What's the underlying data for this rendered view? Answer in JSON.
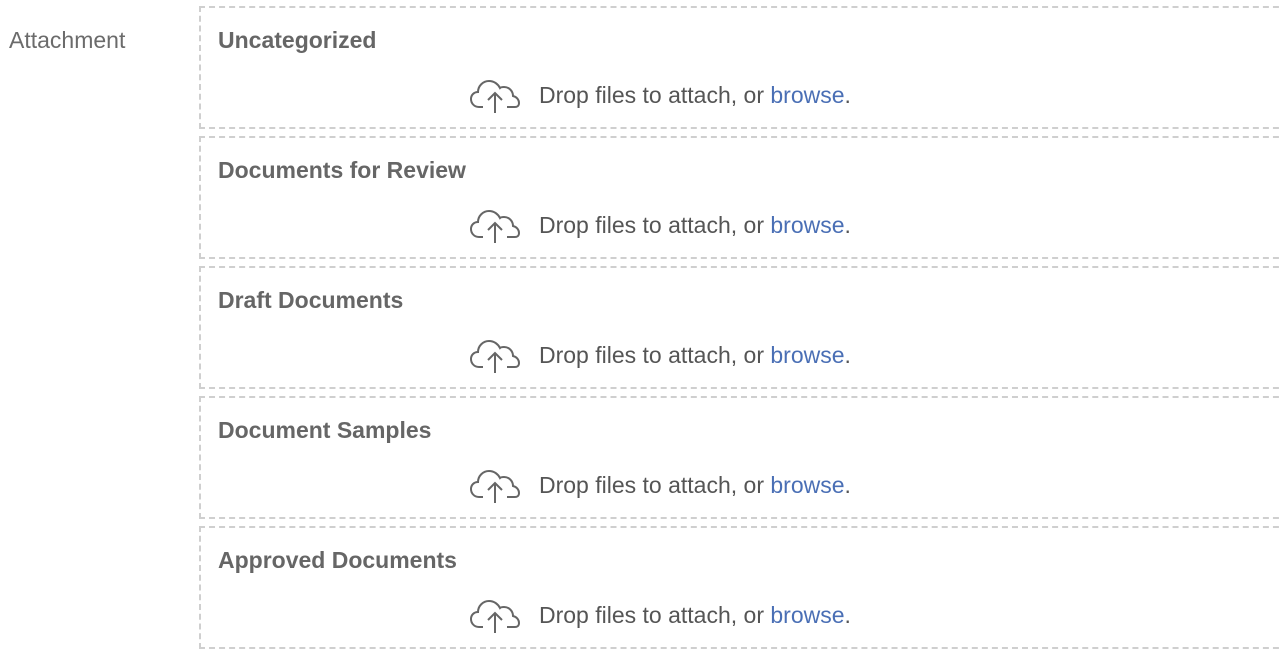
{
  "field": {
    "label": "Attachment"
  },
  "zones": [
    {
      "title": "Uncategorized",
      "prompt": "Drop files to attach, or",
      "link": "browse",
      "period": "."
    },
    {
      "title": "Documents for Review",
      "prompt": "Drop files to attach, or",
      "link": "browse",
      "period": "."
    },
    {
      "title": "Draft Documents",
      "prompt": "Drop files to attach, or",
      "link": "browse",
      "period": "."
    },
    {
      "title": "Document Samples",
      "prompt": "Drop files to attach, or",
      "link": "browse",
      "period": "."
    },
    {
      "title": "Approved Documents",
      "prompt": "Drop files to attach, or",
      "link": "browse",
      "period": "."
    }
  ],
  "icons": {
    "upload": "cloud-upload-icon"
  },
  "colors": {
    "link": "#4a6fb5",
    "dashed_border": "#cfcfcf",
    "title": "#666666",
    "label": "#6b6b6b"
  }
}
